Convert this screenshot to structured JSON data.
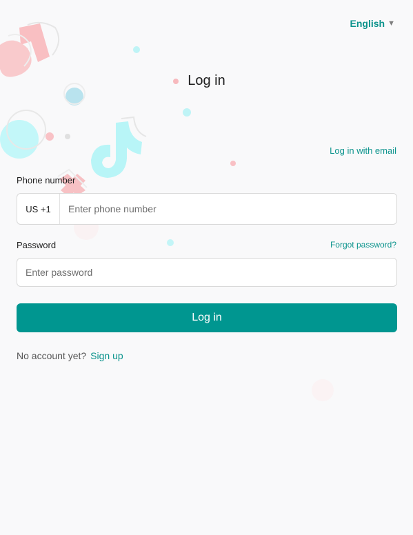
{
  "header": {
    "language": "English",
    "language_caret": "▼"
  },
  "title": "Log in",
  "alt_login_link": "Log in with email",
  "phone": {
    "label": "Phone number",
    "country_code": "US +1",
    "placeholder": "Enter phone number",
    "value": ""
  },
  "password": {
    "label": "Password",
    "forgot_link": "Forgot password?",
    "placeholder": "Enter password",
    "value": ""
  },
  "login_button": "Log in",
  "signup": {
    "prompt": "No account yet?",
    "link": "Sign up"
  },
  "colors": {
    "accent": "#009690",
    "link": "#0b938c",
    "background": "#f9f9fa"
  },
  "icons": {
    "language_caret": "chevron-down-icon",
    "decorations": [
      "tiktok-logo-icon",
      "bubble-icon"
    ]
  }
}
